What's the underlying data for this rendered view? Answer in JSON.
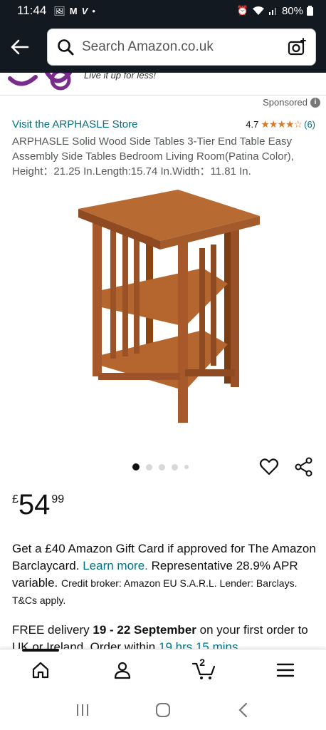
{
  "status_bar": {
    "time": "11:44",
    "icons": [
      "gallery-icon",
      "gmail-icon",
      "v-icon",
      "dot-icon"
    ],
    "battery": "80%"
  },
  "header": {
    "search_placeholder": "Search Amazon.co.uk"
  },
  "banner": {
    "tagline": "Live it up for less!"
  },
  "sponsored_label": "Sponsored",
  "product": {
    "store_link": "Visit the ARPHASLE Store",
    "rating_value": "4.7",
    "stars": "★★★★☆",
    "rating_count": "(6)",
    "title": "ARPHASLE Solid Wood Side Tables 3-Tier End Table Easy Assembly Side Tables Bedroom Living Room(Patina Color), Height：21.25 In.Length:15.74 In.Width：11.81 In.",
    "image_count": 5,
    "active_image": 1,
    "price_symbol": "£",
    "price_whole": "54",
    "price_fraction": "99"
  },
  "promo": {
    "line1": "Get a £40 Amazon Gift Card if approved for The Amazon Barclaycard.",
    "learn_more": "Learn more.",
    "line2": "Representative 28.9% APR variable.",
    "fine_print": "Credit broker: Amazon EU S.A.R.L. Lender: Barclays. T&Cs apply."
  },
  "delivery": {
    "prefix": "FREE delivery",
    "dates": "19 - 22 September",
    "suffix": "on your first order to UK or Ireland. Order within",
    "countdown": "19 hrs 15 mins"
  },
  "bottom_nav": {
    "items": [
      "home-icon",
      "account-icon",
      "cart-icon",
      "menu-icon"
    ],
    "cart_count": "2"
  },
  "colors": {
    "header_bg": "#131921",
    "link": "#007185",
    "star": "#de7921",
    "wood": "#a0522d"
  }
}
